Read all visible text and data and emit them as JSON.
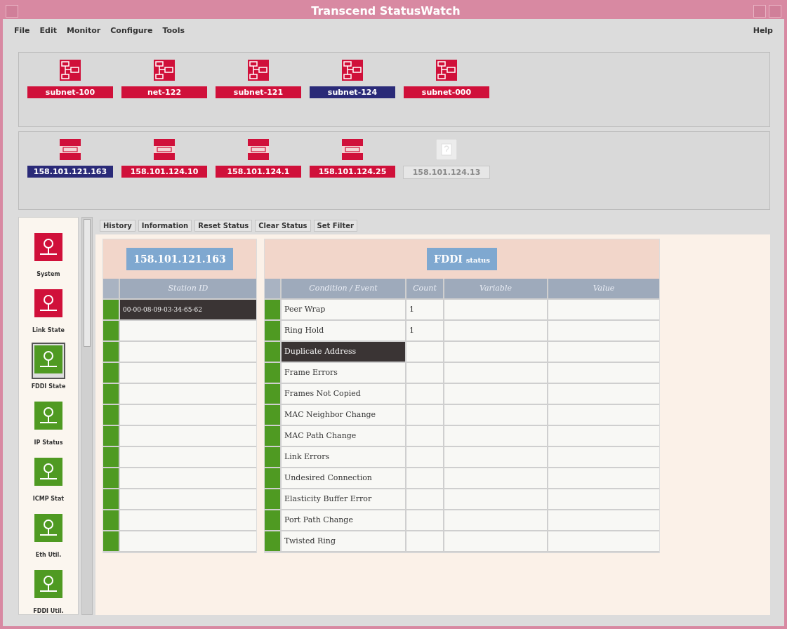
{
  "window": {
    "title": "Transcend StatusWatch"
  },
  "menu": {
    "left": [
      "File",
      "Edit",
      "Monitor",
      "Configure",
      "Tools"
    ],
    "right": "Help"
  },
  "subnets": [
    {
      "label": "subnet-100",
      "selected": false
    },
    {
      "label": "net-122",
      "selected": false
    },
    {
      "label": "subnet-121",
      "selected": false
    },
    {
      "label": "subnet-124",
      "selected": true
    },
    {
      "label": "subnet-000",
      "selected": false
    }
  ],
  "hosts": [
    {
      "label": "158.101.121.163",
      "selected": true,
      "disabled": false
    },
    {
      "label": "158.101.124.10",
      "selected": false,
      "disabled": false
    },
    {
      "label": "158.101.124.1",
      "selected": false,
      "disabled": false
    },
    {
      "label": "158.101.124.25",
      "selected": false,
      "disabled": false
    },
    {
      "label": "158.101.124.13",
      "selected": false,
      "disabled": true
    }
  ],
  "sidebar": {
    "items": [
      {
        "label": "System",
        "color": "#d0103a",
        "selected": false
      },
      {
        "label": "Link State",
        "color": "#d0103a",
        "selected": false
      },
      {
        "label": "FDDI State",
        "color": "#4f9a22",
        "selected": true
      },
      {
        "label": "IP Status",
        "color": "#4f9a22",
        "selected": false
      },
      {
        "label": "ICMP Stat",
        "color": "#4f9a22",
        "selected": false
      },
      {
        "label": "Eth Util.",
        "color": "#4f9a22",
        "selected": false
      },
      {
        "label": "FDDI Util.",
        "color": "#4f9a22",
        "selected": false
      }
    ]
  },
  "toolbar": [
    "History",
    "Information",
    "Reset Status",
    "Clear Status",
    "Set Filter"
  ],
  "station_panel": {
    "title": "158.101.121.163",
    "column": "Station ID",
    "rows": [
      {
        "station_id": "00-00-08-09-03-34-65-62",
        "selected": true
      },
      {
        "station_id": "",
        "selected": false
      },
      {
        "station_id": "",
        "selected": false
      },
      {
        "station_id": "",
        "selected": false
      },
      {
        "station_id": "",
        "selected": false
      },
      {
        "station_id": "",
        "selected": false
      },
      {
        "station_id": "",
        "selected": false
      },
      {
        "station_id": "",
        "selected": false
      },
      {
        "station_id": "",
        "selected": false
      },
      {
        "station_id": "",
        "selected": false
      },
      {
        "station_id": "",
        "selected": false
      },
      {
        "station_id": "",
        "selected": false
      }
    ]
  },
  "status_panel": {
    "title_main": "FDDI",
    "title_sub": "status",
    "columns": [
      "Condition / Event",
      "Count",
      "Variable",
      "Value"
    ],
    "rows": [
      {
        "condition": "Peer Wrap",
        "count": "1",
        "selected": false
      },
      {
        "condition": "Ring Hold",
        "count": "1",
        "selected": false
      },
      {
        "condition": "Duplicate Address",
        "count": "",
        "selected": true
      },
      {
        "condition": "Frame Errors",
        "count": "",
        "selected": false
      },
      {
        "condition": "Frames Not Copied",
        "count": "",
        "selected": false
      },
      {
        "condition": "MAC Neighbor Change",
        "count": "",
        "selected": false
      },
      {
        "condition": "MAC Path Change",
        "count": "",
        "selected": false
      },
      {
        "condition": "Link Errors",
        "count": "",
        "selected": false
      },
      {
        "condition": "Undesired Connection",
        "count": "",
        "selected": false
      },
      {
        "condition": "Elasticity Buffer Error",
        "count": "",
        "selected": false
      },
      {
        "condition": "Port Path Change",
        "count": "",
        "selected": false
      },
      {
        "condition": "Twisted Ring",
        "count": "",
        "selected": false
      }
    ]
  }
}
